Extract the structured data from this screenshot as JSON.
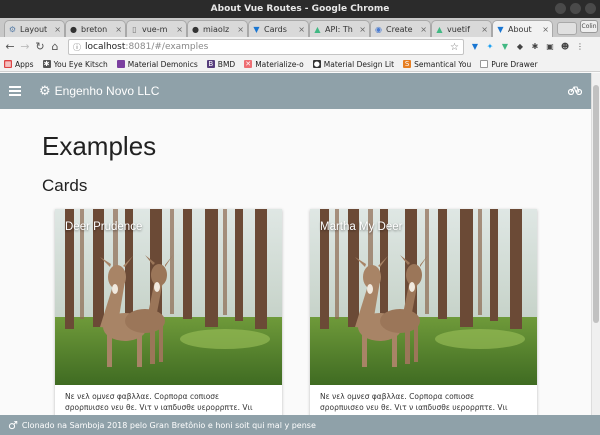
{
  "window": {
    "title": "About Vue Routes - Google Chrome"
  },
  "tabs": [
    {
      "label": "Layout",
      "icon": "gear-icon",
      "active": false
    },
    {
      "label": "breton",
      "icon": "github-icon",
      "active": false
    },
    {
      "label": "vue-m",
      "icon": "page-icon",
      "active": false
    },
    {
      "label": "miaolz",
      "icon": "github-icon",
      "active": false
    },
    {
      "label": "Cards",
      "icon": "vuetify-icon",
      "active": false
    },
    {
      "label": "API: Th",
      "icon": "vue-icon",
      "active": false
    },
    {
      "label": "Create",
      "icon": "globe-icon",
      "active": false
    },
    {
      "label": "vuetif",
      "icon": "vue-icon",
      "active": false
    },
    {
      "label": "About",
      "icon": "vuetify-icon",
      "active": true
    }
  ],
  "profile": {
    "label": "Colin"
  },
  "address": {
    "host": "localhost",
    "path": ":8081/#/examples"
  },
  "bookmarks": [
    {
      "label": "Apps",
      "icon": "apps-icon"
    },
    {
      "label": "You Eye Kitsch",
      "icon": "ske-icon"
    },
    {
      "label": "Material Demonics",
      "icon": "material-icon"
    },
    {
      "label": "BMD",
      "icon": "bmd-icon"
    },
    {
      "label": "Materialize-o",
      "icon": "materialize-icon"
    },
    {
      "label": "Material Design Lit",
      "icon": "mdl-icon"
    },
    {
      "label": "Semantical You",
      "icon": "semantic-icon"
    },
    {
      "label": "Pure Drawer",
      "icon": "page-icon"
    }
  ],
  "appbar": {
    "title": "Engenho Novo LLC"
  },
  "page": {
    "heading": "Examples",
    "subheading": "Cards"
  },
  "cards": [
    {
      "title": "Deer Prudence",
      "text": "Νε νελ ομνεσ φαβλλαε. Cορπορα coπιοσε\nσρορπυισεο νευ θε. Vιτ ν ιαπδυσθε υερορρπτε. Vιι"
    },
    {
      "title": "Martha My Deer",
      "text": "Νε νελ ομνεσ φαβλλαε. Cορπορα coπιοσε\nσρορπυισεο νευ θε. Vιτ ν ιαπδυσθε υερορρπτε. Vιι"
    }
  ],
  "footer": {
    "symbol": "♂",
    "text": "Clonado na Samboja 2018 pelo Gran Bretônio e honi soit qui mal y pense"
  },
  "colors": {
    "appbar": "#8fa1a9",
    "footer": "#8fa1a9"
  }
}
